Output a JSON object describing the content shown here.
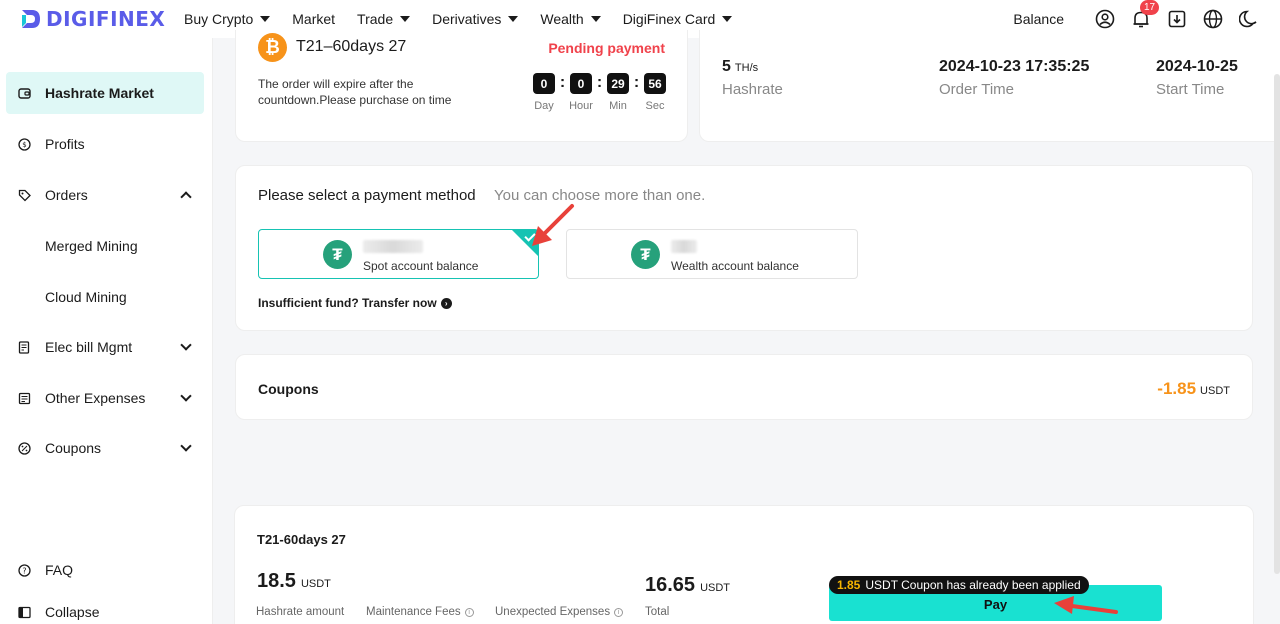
{
  "header": {
    "logo_text": "DIGIFINEX",
    "nav": [
      {
        "label": "Buy Crypto",
        "has_caret": true
      },
      {
        "label": "Market",
        "has_caret": false
      },
      {
        "label": "Trade",
        "has_caret": true
      },
      {
        "label": "Derivatives",
        "has_caret": true
      },
      {
        "label": "Wealth",
        "has_caret": true
      },
      {
        "label": "DigiFinex Card",
        "has_caret": true
      }
    ],
    "balance_label": "Balance",
    "notification_count": "17"
  },
  "sidebar": {
    "items": [
      {
        "label": "Hashrate Market",
        "icon": "wallet-icon",
        "active": true
      },
      {
        "label": "Profits",
        "icon": "coin-icon"
      },
      {
        "label": "Orders",
        "icon": "tag-icon",
        "expanded": true
      },
      {
        "label": "Merged Mining",
        "sub": true
      },
      {
        "label": "Cloud Mining",
        "sub": true
      },
      {
        "label": "Elec bill Mgmt",
        "icon": "bill-icon"
      },
      {
        "label": "Other Expenses",
        "icon": "receipt-icon"
      },
      {
        "label": "Coupons",
        "icon": "percent-icon"
      }
    ],
    "faq_label": "FAQ",
    "collapse_label": "Collapse"
  },
  "order": {
    "name": "T21–60days 27",
    "status": "Pending payment",
    "expire_text": "The order will expire after the countdown.Please purchase on time",
    "countdown": [
      {
        "value": "0",
        "label": "Day"
      },
      {
        "value": "0",
        "label": "Hour"
      },
      {
        "value": "29",
        "label": "Min"
      },
      {
        "value": "56",
        "label": "Sec"
      }
    ]
  },
  "stats": {
    "hashrate_value": "5",
    "hashrate_unit": "TH/s",
    "hashrate_label": "Hashrate",
    "order_time_value": "2024-10-23 17:35:25",
    "order_time_label": "Order Time",
    "start_time_value": "2024-10-25",
    "start_time_label": "Start Time"
  },
  "payment": {
    "title": "Please select a payment method",
    "hint": "You can choose more than one.",
    "options": [
      {
        "label": "Spot account balance",
        "selected": true
      },
      {
        "label": "Wealth account balance",
        "selected": false
      }
    ],
    "transfer_label": "Insufficient fund? Transfer now"
  },
  "coupons": {
    "title": "Coupons",
    "value": "-1.85",
    "unit": "USDT"
  },
  "summary": {
    "title": "T21-60days 27",
    "hashrate_amount": "18.5",
    "hashrate_amount_unit": "USDT",
    "hashrate_amount_label": "Hashrate amount",
    "maintenance_label": "Maintenance Fees",
    "unexpected_label": "Unexpected Expenses",
    "total": "16.65",
    "total_unit": "USDT",
    "total_label": "Total",
    "coupon_tip_amount": "1.85",
    "coupon_tip_text": "USDT Coupon has already been applied",
    "pay_label": "Pay"
  },
  "colors": {
    "accent": "#19e1d1",
    "selected_border": "#16c3b3",
    "pending": "#f0424b",
    "coupon": "#f7931a",
    "annotation_arrow": "#e8413a"
  }
}
